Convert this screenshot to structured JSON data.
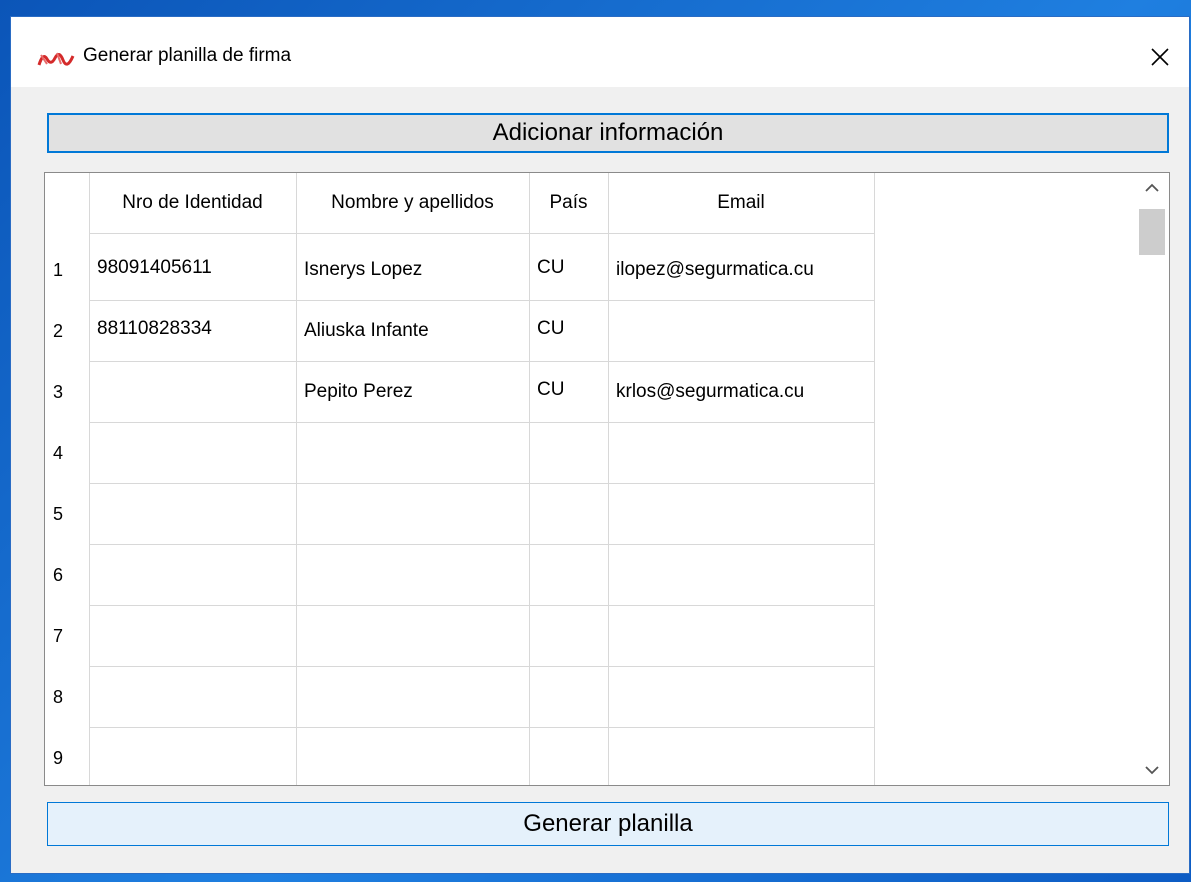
{
  "window": {
    "title": "Generar planilla de firma",
    "accent_color": "#0078d7"
  },
  "icons": {
    "app": "app-logo-icon",
    "close": "close-icon",
    "scroll_up": "chevron-up-icon",
    "scroll_down": "chevron-down-icon"
  },
  "buttons": {
    "add_info": "Adicionar información",
    "generate": "Generar planilla"
  },
  "table": {
    "columns": [
      "Nro de Identidad",
      "Nombre y apellidos",
      "País",
      "Email"
    ],
    "row_numbers": [
      "1",
      "2",
      "3",
      "4",
      "5",
      "6",
      "7",
      "8",
      "9"
    ],
    "rows": [
      [
        "98091405611",
        "Isnerys Lopez",
        "CU",
        "ilopez@segurmatica.cu"
      ],
      [
        "88110828334",
        "Aliuska Infante",
        "CU",
        ""
      ],
      [
        "",
        "Pepito Perez",
        "CU",
        "krlos@segurmatica.cu"
      ],
      [
        "",
        "",
        "",
        ""
      ],
      [
        "",
        "",
        "",
        ""
      ],
      [
        "",
        "",
        "",
        ""
      ],
      [
        "",
        "",
        "",
        ""
      ],
      [
        "",
        "",
        "",
        ""
      ],
      [
        "",
        "",
        "",
        ""
      ]
    ]
  }
}
